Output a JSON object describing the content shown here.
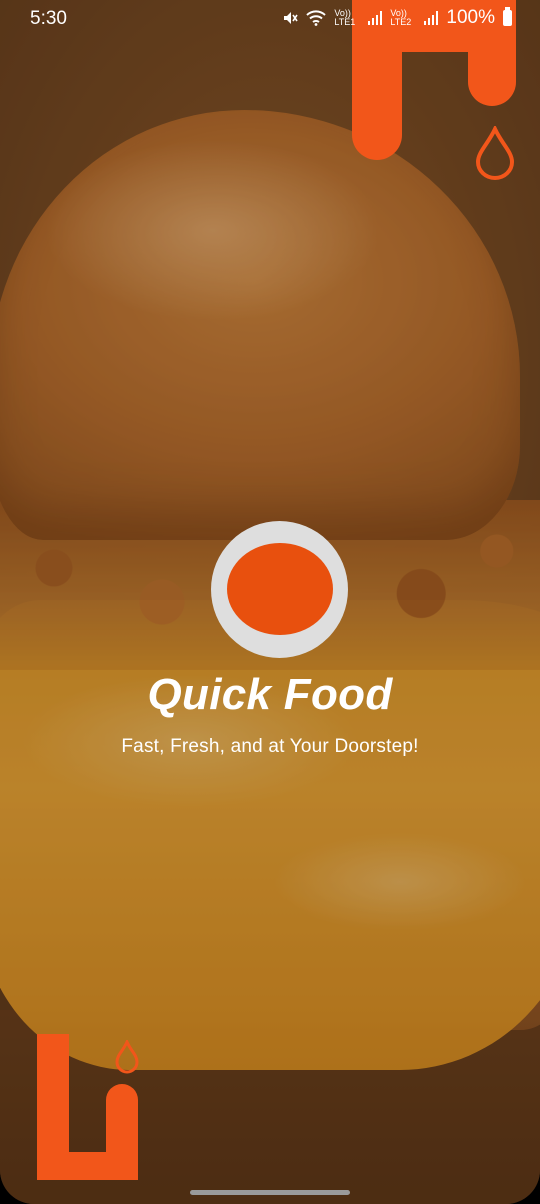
{
  "status_bar": {
    "time": "5:30",
    "network_label_1": "Vo)) LTE1",
    "network_label_2": "Vo)) LTE2",
    "battery": "100%"
  },
  "splash": {
    "title": "Quick Food",
    "tagline": "Fast, Fresh, and at Your Doorstep!"
  },
  "colors": {
    "accent": "#f2561a",
    "logo_dot": "#e8500e",
    "logo_ring": "#dedede"
  },
  "icons": [
    "mute-icon",
    "wifi-icon",
    "signal-icon",
    "battery-icon",
    "drop-icon",
    "logo-icon"
  ]
}
